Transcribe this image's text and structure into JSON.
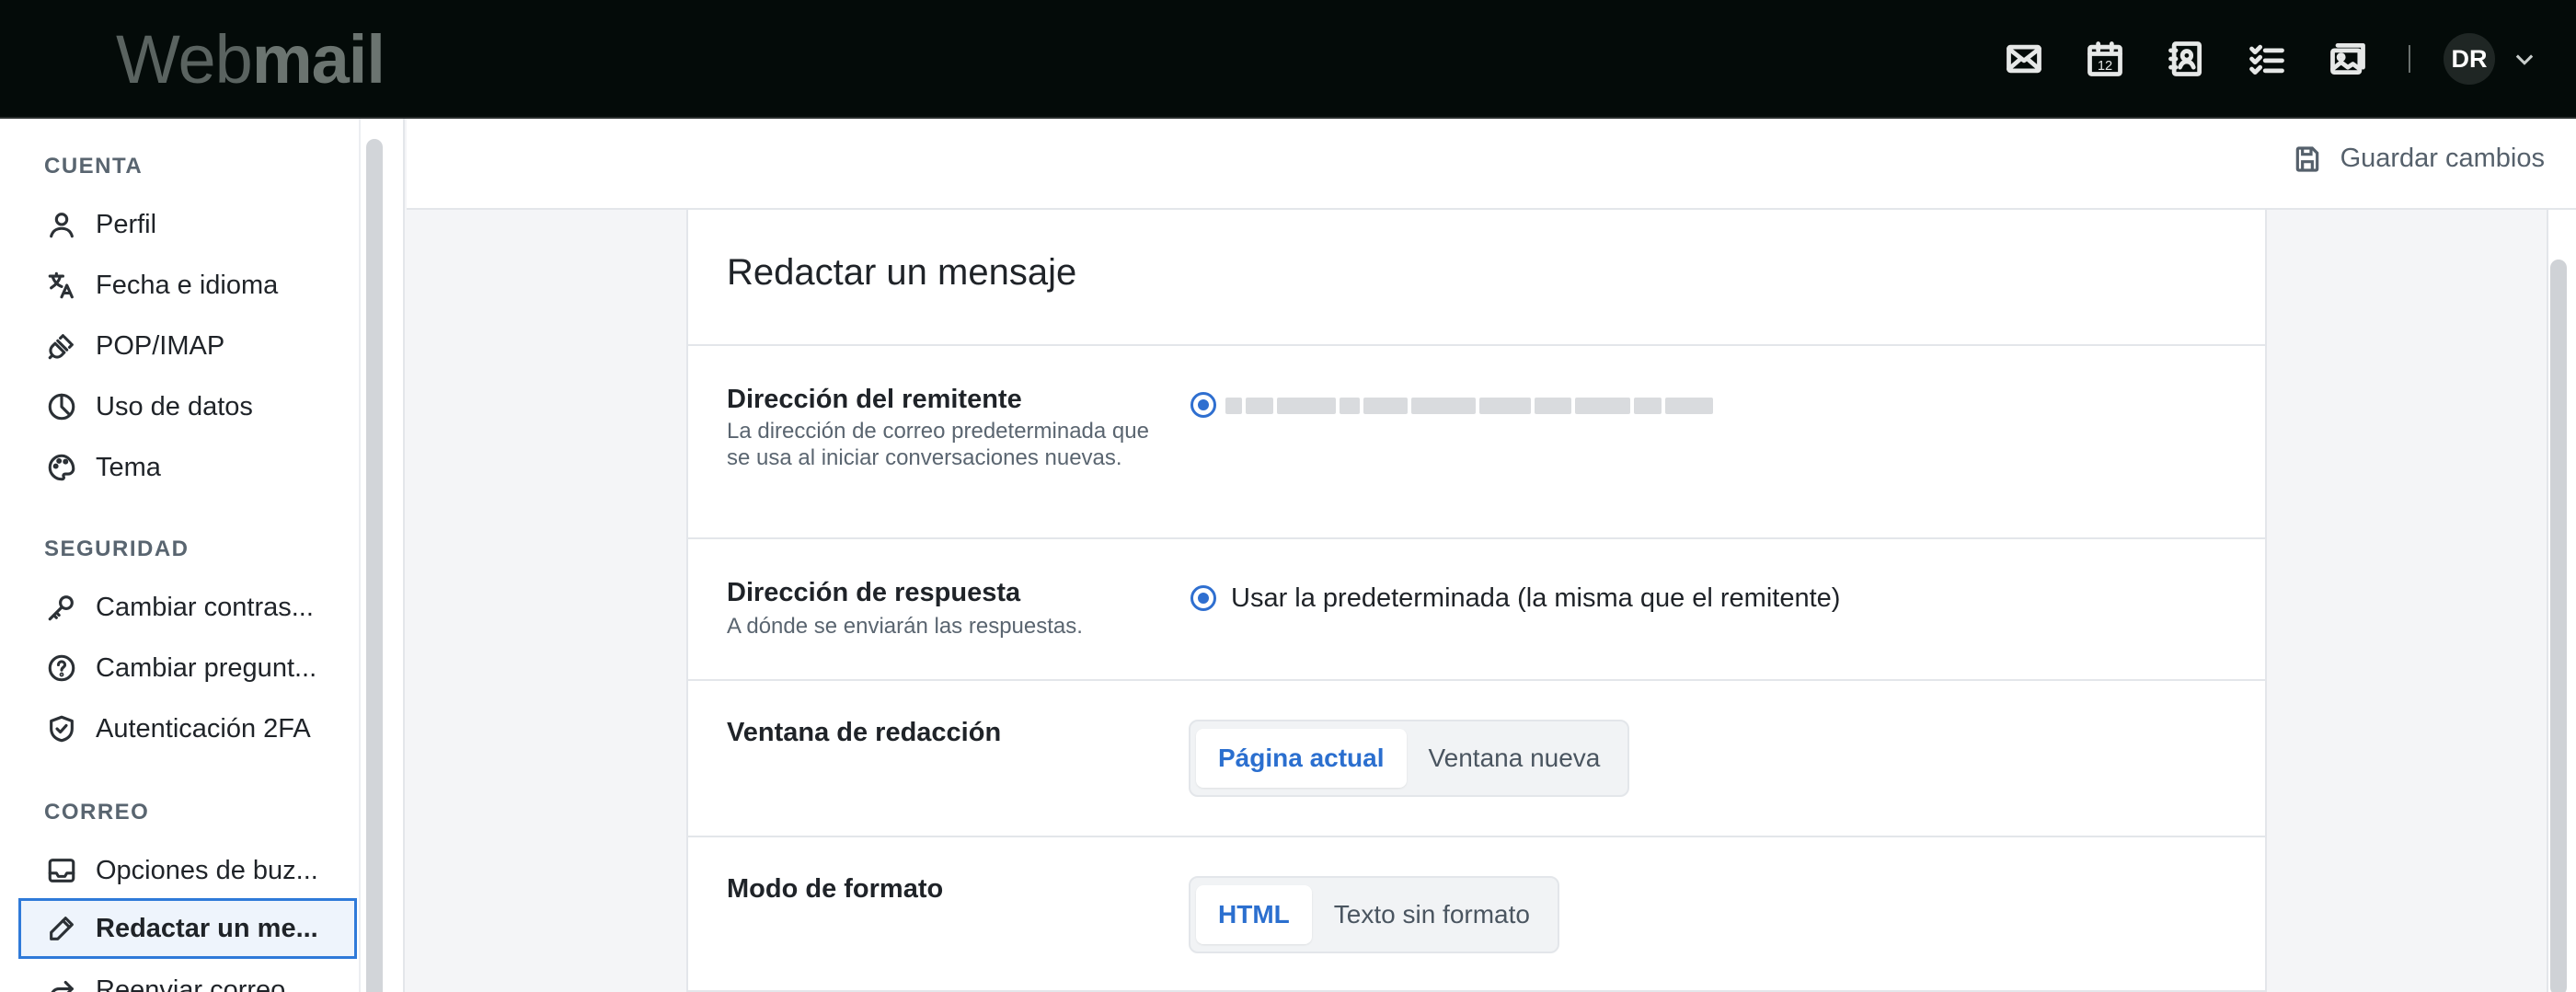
{
  "app": {
    "logo_light": "Web",
    "logo_bold": "mail",
    "avatar_initials": "DR"
  },
  "top_icons": [
    "mail-icon",
    "calendar-icon",
    "contacts-icon",
    "tasks-icon",
    "photos-icon"
  ],
  "calendar_day": "12",
  "sidebar": {
    "sections": [
      {
        "title": "CUENTA"
      },
      {
        "title": "SEGURIDAD"
      },
      {
        "title": "CORREO"
      }
    ],
    "items": [
      {
        "label": "Perfil",
        "icon": "user-icon"
      },
      {
        "label": "Fecha e idioma",
        "icon": "translate-icon"
      },
      {
        "label": "POP/IMAP",
        "icon": "plug-icon"
      },
      {
        "label": "Uso de datos",
        "icon": "pie-chart-icon"
      },
      {
        "label": "Tema",
        "icon": "palette-icon"
      },
      {
        "label": "Cambiar contras...",
        "icon": "key-icon"
      },
      {
        "label": "Cambiar pregunt...",
        "icon": "question-icon"
      },
      {
        "label": "Autenticación 2FA",
        "icon": "shield-check-icon"
      },
      {
        "label": "Opciones de buz...",
        "icon": "inbox-icon"
      },
      {
        "label": "Redactar un me...",
        "icon": "pencil-icon",
        "active": true
      },
      {
        "label": "Reenviar correo",
        "icon": "forward-icon"
      }
    ]
  },
  "toolbar": {
    "save_label": "Guardar cambios"
  },
  "card": {
    "title": "Redactar un mensaje",
    "sender": {
      "label": "Dirección del remitente",
      "desc": "La dirección de correo predeterminada que se usa al iniciar conversaciones nuevas."
    },
    "reply": {
      "label": "Dirección de respuesta",
      "desc": "A dónde se enviarán las respuestas.",
      "option": "Usar la predeterminada (la misma que el remitente)"
    },
    "window": {
      "label": "Ventana de redacción",
      "options": [
        "Página actual",
        "Ventana nueva"
      ],
      "selected": "Página actual"
    },
    "format": {
      "label": "Modo de formato",
      "options": [
        "HTML",
        "Texto sin formato"
      ],
      "selected": "HTML"
    }
  },
  "colors": {
    "accent": "#2f6fd0",
    "topbar": "#040b09",
    "active_border": "#2f7ad9"
  }
}
